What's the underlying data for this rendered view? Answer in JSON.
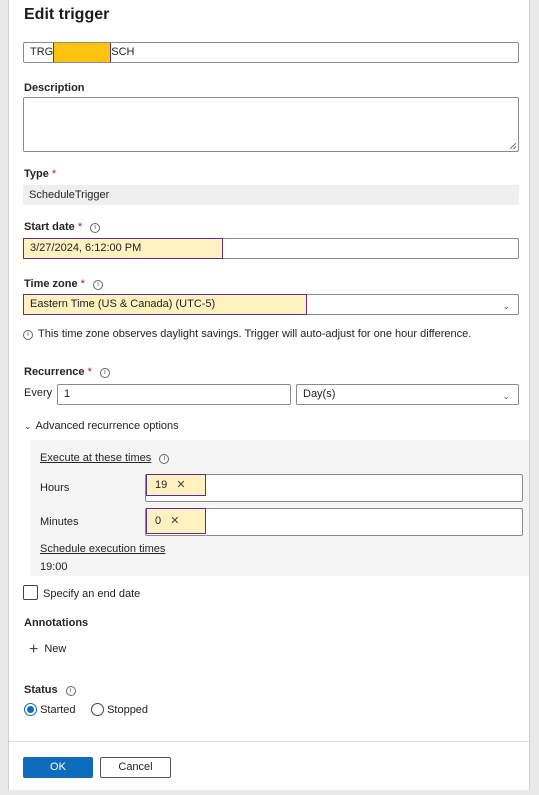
{
  "dialog": {
    "title": "Edit trigger"
  },
  "name": {
    "value_prefix": "TRG",
    "value_suffix": "SCH"
  },
  "description": {
    "label": "Description",
    "value": ""
  },
  "type": {
    "label": "Type",
    "required_mark": "*",
    "value": "ScheduleTrigger"
  },
  "start_date": {
    "label": "Start date",
    "required_mark": "*",
    "value": "3/27/2024, 6:12:00 PM"
  },
  "time_zone": {
    "label": "Time zone",
    "required_mark": "*",
    "value": "Eastern Time (US & Canada) (UTC-5)",
    "note": "This time zone observes daylight savings. Trigger will auto-adjust for one hour difference."
  },
  "recurrence": {
    "label": "Recurrence",
    "required_mark": "*",
    "every_label": "Every",
    "interval": "1",
    "unit": "Day(s)"
  },
  "advanced": {
    "toggle_label": "Advanced recurrence options",
    "execute_label": "Execute at these times",
    "hours_label": "Hours",
    "hours_value": "19",
    "minutes_label": "Minutes",
    "minutes_value": "0",
    "schedule_link": "Schedule execution times",
    "schedule_value": "19:00"
  },
  "end_date": {
    "label": "Specify an end date",
    "checked": false
  },
  "annotations": {
    "label": "Annotations",
    "new_label": "New"
  },
  "status": {
    "label": "Status",
    "options": [
      "Started",
      "Stopped"
    ],
    "selected": "Started"
  },
  "footer": {
    "ok_label": "OK",
    "cancel_label": "Cancel"
  },
  "colors": {
    "primary": "#0f6cbd",
    "highlight": "#fff2c0",
    "highlight_border": "#5c2d91",
    "redaction": "#ffc20e"
  }
}
